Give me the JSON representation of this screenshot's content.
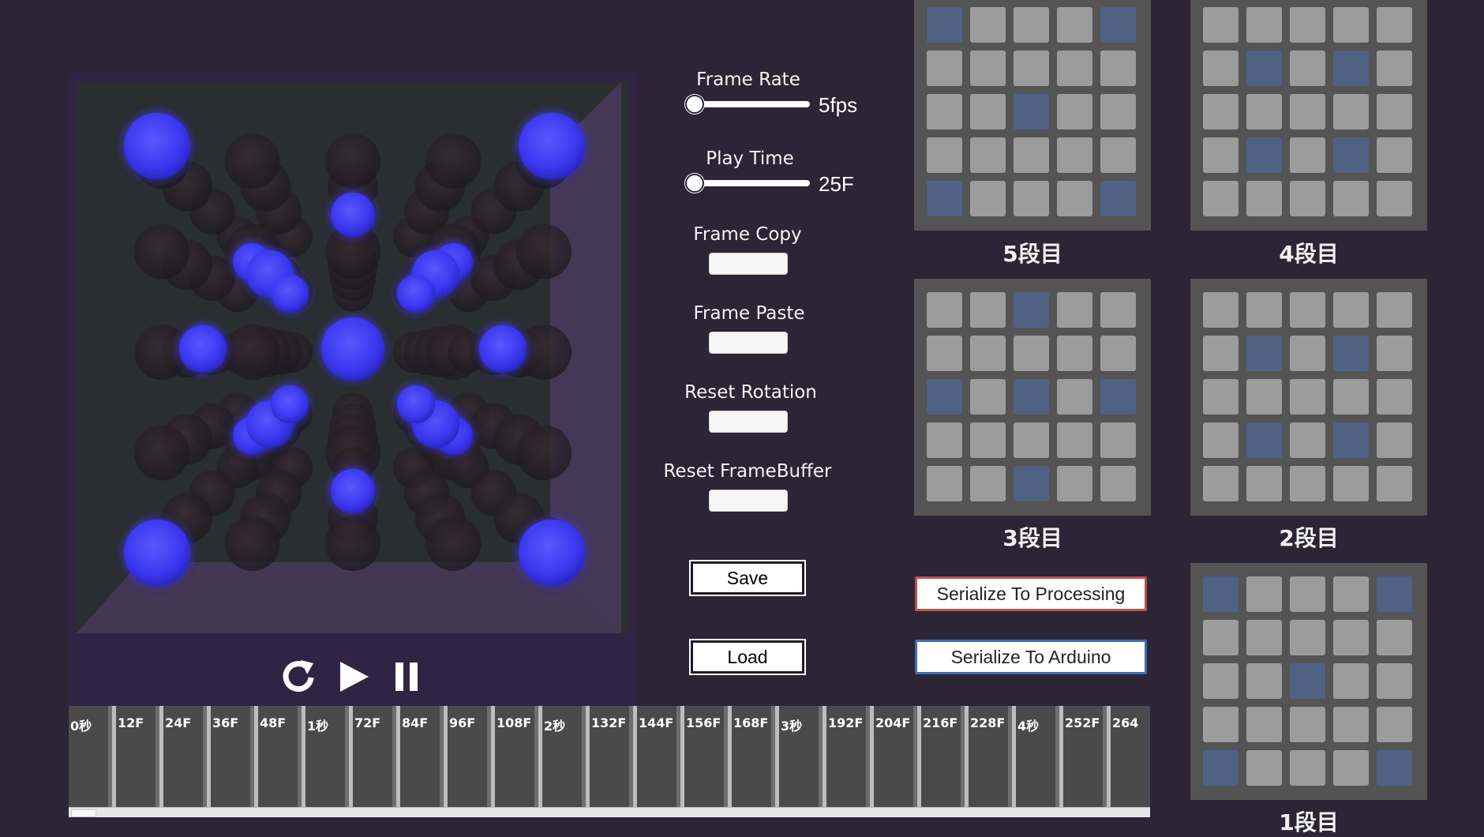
{
  "viewport": {
    "spheres_label": "3D LED cube preview"
  },
  "playback": {
    "reload_icon": "reload-icon",
    "play_icon": "play-icon",
    "pause_icon": "pause-icon"
  },
  "controls": {
    "frame_rate": {
      "label": "Frame Rate",
      "value": "5fps",
      "level": 0.0
    },
    "play_time": {
      "label": "Play Time",
      "value": "25F",
      "level": 0.0
    },
    "frame_copy": {
      "label": "Frame Copy"
    },
    "frame_paste": {
      "label": "Frame Paste"
    },
    "reset_rotation": {
      "label": "Reset Rotation"
    },
    "reset_framebuffer": {
      "label": "Reset FrameBuffer"
    },
    "save_label": "Save",
    "load_label": "Load",
    "serialize_processing": "Serialize To Processing",
    "serialize_arduino": "Serialize To Arduino"
  },
  "colors": {
    "background": "#2b2535",
    "cell_off": "#9c9c9c",
    "cell_on": "#4f6284",
    "sphere_on": "#3f3cff",
    "processing_border": "#c0504d",
    "arduino_border": "#3c6fb0"
  },
  "layers": [
    {
      "label": "5段目",
      "on": [
        [
          0,
          0
        ],
        [
          0,
          4
        ],
        [
          2,
          2
        ],
        [
          4,
          0
        ],
        [
          4,
          4
        ]
      ]
    },
    {
      "label": "4段目",
      "on": [
        [
          1,
          1
        ],
        [
          1,
          3
        ],
        [
          3,
          1
        ],
        [
          3,
          3
        ]
      ]
    },
    {
      "label": "3段目",
      "on": [
        [
          0,
          2
        ],
        [
          2,
          0
        ],
        [
          2,
          2
        ],
        [
          2,
          4
        ],
        [
          4,
          2
        ]
      ]
    },
    {
      "label": "2段目",
      "on": [
        [
          1,
          1
        ],
        [
          1,
          3
        ],
        [
          3,
          1
        ],
        [
          3,
          3
        ]
      ]
    },
    {
      "label": "1段目",
      "on": [
        [
          0,
          0
        ],
        [
          0,
          4
        ],
        [
          2,
          2
        ],
        [
          4,
          0
        ],
        [
          4,
          4
        ]
      ]
    }
  ],
  "timeline": {
    "labels": [
      "0秒",
      "12F",
      "24F",
      "36F",
      "48F",
      "1秒",
      "72F",
      "84F",
      "96F",
      "108F",
      "2秒",
      "132F",
      "144F",
      "156F",
      "168F",
      "3秒",
      "192F",
      "204F",
      "216F",
      "228F",
      "4秒",
      "252F",
      "264"
    ],
    "scroll_position": 0.0
  }
}
